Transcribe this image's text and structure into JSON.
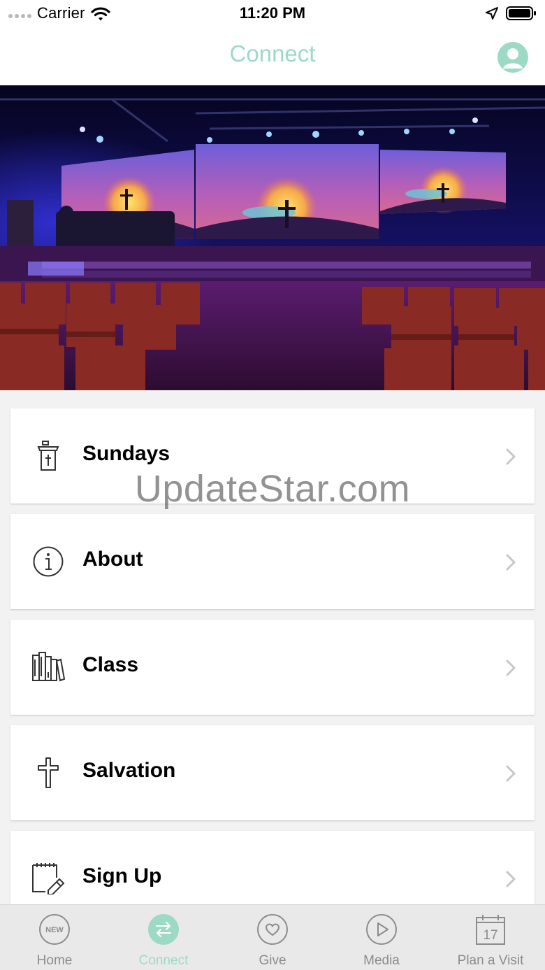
{
  "status_bar": {
    "carrier": "Carrier",
    "time": "11:20 PM"
  },
  "nav": {
    "title": "Connect"
  },
  "list": {
    "items": [
      {
        "label": "Sundays",
        "icon": "pulpit-icon"
      },
      {
        "label": "About",
        "icon": "info-icon"
      },
      {
        "label": "Class",
        "icon": "books-icon"
      },
      {
        "label": "Salvation",
        "icon": "cross-icon"
      },
      {
        "label": "Sign Up",
        "icon": "notepad-pencil-icon"
      }
    ]
  },
  "watermark": "UpdateStar.com",
  "tabs": [
    {
      "label": "Home",
      "icon": "new-badge-icon",
      "badge": "NEW"
    },
    {
      "label": "Connect",
      "icon": "exchange-arrows-icon",
      "active": true
    },
    {
      "label": "Give",
      "icon": "heart-icon"
    },
    {
      "label": "Media",
      "icon": "play-icon"
    },
    {
      "label": "Plan a Visit",
      "icon": "calendar-icon",
      "day": "17"
    }
  ],
  "colors": {
    "accent": "#9ddac6",
    "tab_inactive": "#8c8c8c",
    "background": "#f2f2f2"
  }
}
